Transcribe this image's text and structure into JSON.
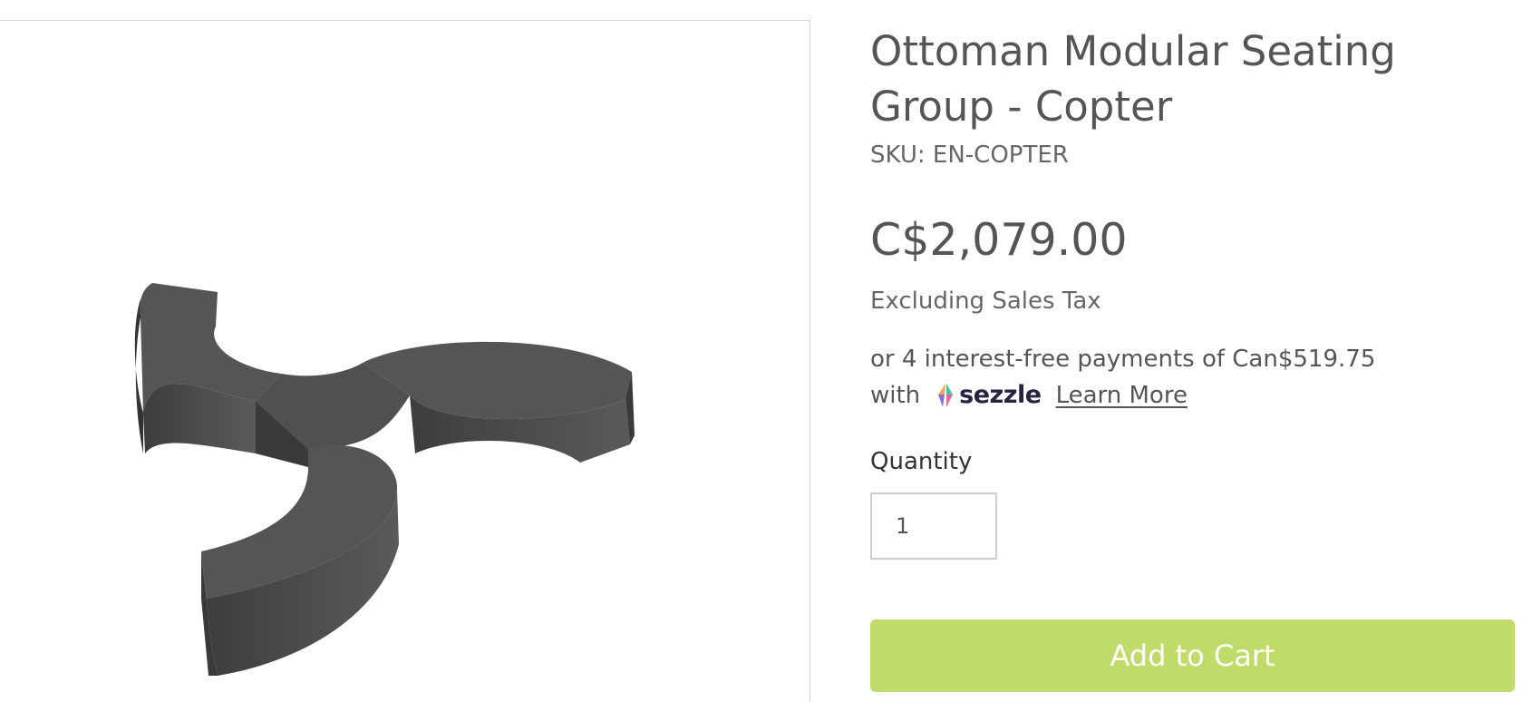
{
  "product": {
    "title": "Ottoman Modular Seating Group - Copter",
    "sku": "SKU: EN-COPTER",
    "price": "C$2,079.00",
    "tax_note": "Excluding Sales Tax"
  },
  "financing": {
    "text_line1": "or 4 interest-free payments of Can$519.75",
    "text_with": "with",
    "provider": "sezzle",
    "learn_more": "Learn More"
  },
  "quantity": {
    "label": "Quantity",
    "value": "1"
  },
  "cart": {
    "add_label": "Add to Cart"
  },
  "colors": {
    "accent_button": "#c1db6b",
    "text": "#555555",
    "product_fill": "#4a4a4a"
  },
  "icons": [
    "sezzle-logo-icon"
  ]
}
